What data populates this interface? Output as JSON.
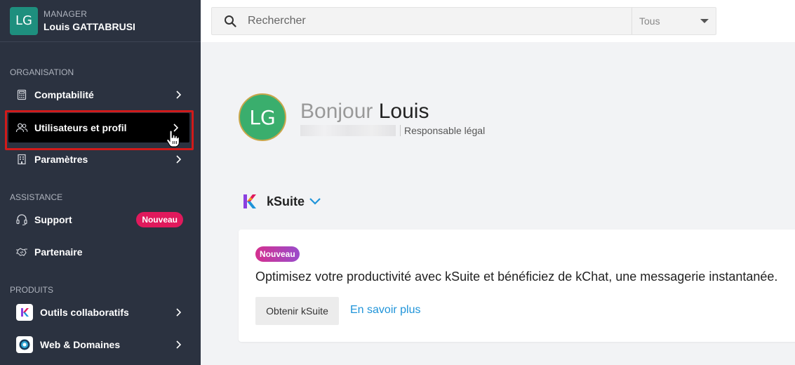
{
  "user": {
    "role": "MANAGER",
    "name": "Louis GATTABRUSI",
    "initials": "LG"
  },
  "sidebar": {
    "sections": [
      {
        "title": "ORGANISATION"
      },
      {
        "title": "ASSISTANCE"
      },
      {
        "title": "PRODUITS"
      }
    ],
    "items": [
      {
        "label": "Comptabilité",
        "icon": "calculator-icon"
      },
      {
        "label": "Utilisateurs et profil",
        "icon": "users-icon",
        "active": true
      },
      {
        "label": "Paramètres",
        "icon": "building-icon"
      },
      {
        "label": "Support",
        "icon": "headset-icon",
        "badge": "Nouveau"
      },
      {
        "label": "Partenaire",
        "icon": "handshake-icon"
      },
      {
        "label": "Outils collaboratifs",
        "icon": "ksuite-app-icon"
      },
      {
        "label": "Web & Domaines",
        "icon": "web-domains-app-icon"
      }
    ]
  },
  "search": {
    "placeholder": "Rechercher",
    "filter": "Tous"
  },
  "main": {
    "greeting_hello": "Bonjour",
    "greeting_name": "Louis",
    "role": "Responsable légal",
    "product": "kSuite",
    "card": {
      "badge": "Nouveau",
      "text": "Optimisez votre productivité avec kSuite et bénéficiez de kChat, une messagerie instantanée.",
      "button": "Obtenir kSuite",
      "link": "En savoir plus"
    }
  },
  "colors": {
    "sidebar": "#2b3240",
    "accent_link": "#1f94d9",
    "badge_red": "#e0195c",
    "highlight": "#d11a1a"
  }
}
